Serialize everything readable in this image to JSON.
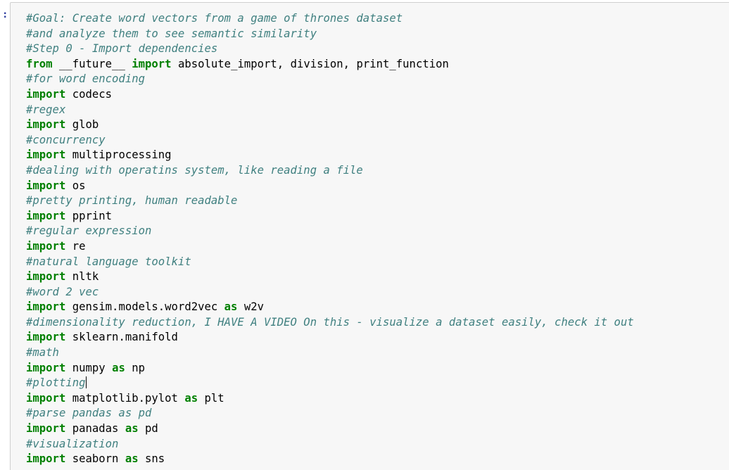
{
  "cell": {
    "prompt": ":",
    "lines": [
      {
        "type": "comment",
        "text": "#Goal: Create word vectors from a game of thrones dataset"
      },
      {
        "type": "comment",
        "text": "#and analyze them to see semantic similarity"
      },
      {
        "type": "comment",
        "text": "#Step 0 - Import dependencies"
      },
      {
        "type": "code",
        "parts": [
          {
            "kind": "kw",
            "text": "from"
          },
          {
            "kind": "plain",
            "text": " __future__ "
          },
          {
            "kind": "kw",
            "text": "import"
          },
          {
            "kind": "plain",
            "text": " absolute_import, division, print_function"
          }
        ]
      },
      {
        "type": "comment",
        "text": "#for word encoding"
      },
      {
        "type": "code",
        "parts": [
          {
            "kind": "kw",
            "text": "import"
          },
          {
            "kind": "plain",
            "text": " codecs"
          }
        ]
      },
      {
        "type": "comment",
        "text": "#regex"
      },
      {
        "type": "code",
        "parts": [
          {
            "kind": "kw",
            "text": "import"
          },
          {
            "kind": "plain",
            "text": " glob"
          }
        ]
      },
      {
        "type": "comment",
        "text": "#concurrency"
      },
      {
        "type": "code",
        "parts": [
          {
            "kind": "kw",
            "text": "import"
          },
          {
            "kind": "plain",
            "text": " multiprocessing"
          }
        ]
      },
      {
        "type": "comment",
        "text": "#dealing with operatins system, like reading a file"
      },
      {
        "type": "code",
        "parts": [
          {
            "kind": "kw",
            "text": "import"
          },
          {
            "kind": "plain",
            "text": " os"
          }
        ]
      },
      {
        "type": "comment",
        "text": "#pretty printing, human readable"
      },
      {
        "type": "code",
        "parts": [
          {
            "kind": "kw",
            "text": "import"
          },
          {
            "kind": "plain",
            "text": " pprint"
          }
        ]
      },
      {
        "type": "comment",
        "text": "#regular expression"
      },
      {
        "type": "code",
        "parts": [
          {
            "kind": "kw",
            "text": "import"
          },
          {
            "kind": "plain",
            "text": " re"
          }
        ]
      },
      {
        "type": "comment",
        "text": "#natural language toolkit"
      },
      {
        "type": "code",
        "parts": [
          {
            "kind": "kw",
            "text": "import"
          },
          {
            "kind": "plain",
            "text": " nltk"
          }
        ]
      },
      {
        "type": "comment",
        "text": "#word 2 vec"
      },
      {
        "type": "code",
        "parts": [
          {
            "kind": "kw",
            "text": "import"
          },
          {
            "kind": "plain",
            "text": " gensim.models.word2vec "
          },
          {
            "kind": "kw",
            "text": "as"
          },
          {
            "kind": "plain",
            "text": " w2v"
          }
        ]
      },
      {
        "type": "comment",
        "text": "#dimensionality reduction, I HAVE A VIDEO On this - visualize a dataset easily, check it out"
      },
      {
        "type": "code",
        "parts": [
          {
            "kind": "kw",
            "text": "import"
          },
          {
            "kind": "plain",
            "text": " sklearn.manifold"
          }
        ]
      },
      {
        "type": "comment",
        "text": "#math"
      },
      {
        "type": "code",
        "parts": [
          {
            "kind": "kw",
            "text": "import"
          },
          {
            "kind": "plain",
            "text": " numpy "
          },
          {
            "kind": "kw",
            "text": "as"
          },
          {
            "kind": "plain",
            "text": " np"
          }
        ]
      },
      {
        "type": "comment",
        "text": "#plotting",
        "cursor": true
      },
      {
        "type": "code",
        "parts": [
          {
            "kind": "kw",
            "text": "import"
          },
          {
            "kind": "plain",
            "text": " matplotlib.pylot "
          },
          {
            "kind": "kw",
            "text": "as"
          },
          {
            "kind": "plain",
            "text": " plt"
          }
        ]
      },
      {
        "type": "comment",
        "text": "#parse pandas as pd"
      },
      {
        "type": "code",
        "parts": [
          {
            "kind": "kw",
            "text": "import"
          },
          {
            "kind": "plain",
            "text": " panadas "
          },
          {
            "kind": "kw",
            "text": "as"
          },
          {
            "kind": "plain",
            "text": " pd"
          }
        ]
      },
      {
        "type": "comment",
        "text": "#visualization"
      },
      {
        "type": "code",
        "parts": [
          {
            "kind": "kw",
            "text": "import"
          },
          {
            "kind": "plain",
            "text": " seaborn "
          },
          {
            "kind": "kw",
            "text": "as"
          },
          {
            "kind": "plain",
            "text": " sns"
          }
        ]
      }
    ]
  },
  "colors": {
    "comment": "#408080",
    "keyword": "#008000",
    "plain": "#000000",
    "cell_background": "#f7f7f7",
    "cell_border": "#cfcfcf"
  }
}
